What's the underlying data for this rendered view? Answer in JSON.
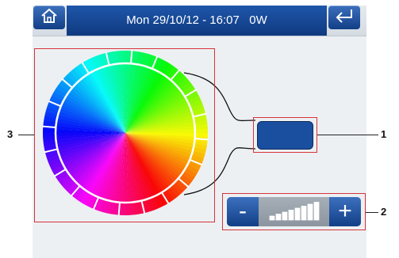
{
  "header": {
    "title": "Mon 29/10/12 - 16:07   0W",
    "home_icon": "home-icon",
    "back_icon": "return-icon"
  },
  "color_wheel": {
    "segments": 20
  },
  "selected_color": "#1a4fa0",
  "brightness": {
    "minus_label": "-",
    "plus_label": "+",
    "level_bars": 8,
    "level_filled": 8
  },
  "callouts": {
    "one": "1",
    "two": "2",
    "three": "3"
  },
  "colors": {
    "accent": "#1b4d9c",
    "callout_red": "#d6333b"
  }
}
